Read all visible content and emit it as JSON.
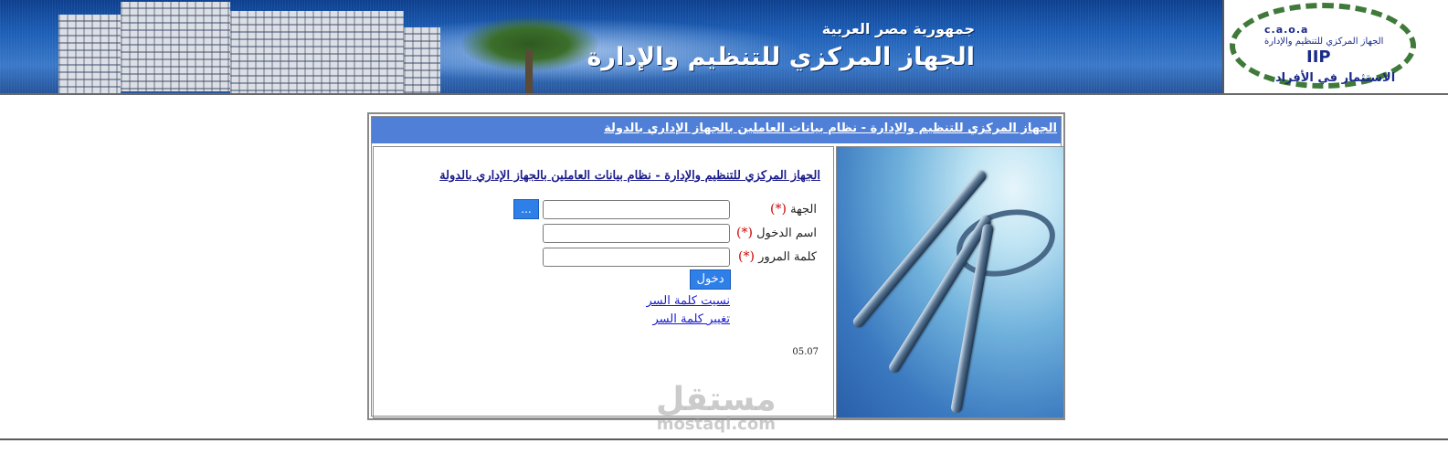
{
  "banner": {
    "subtitle": "جمهورية مصر العربية",
    "title": "الجهاز المركزي للتنظيم والإدارة",
    "logo_top": "c.a.o.a",
    "logo_sub": "الجهاز المركزي للتنظيم والإدارة",
    "logo_center": "IIP",
    "logo_bottom": "الاستثمار في الأفراد"
  },
  "frame": {
    "title": "الجهاز المركزي للتنظيم والإدارة - نظام بيانات العاملين بالجهاز الإداري بالدولة",
    "heading": "الجهاز المركزي للتنظيم والإدارة - نظام بيانات العاملين بالجهاز الإداري بالدولة"
  },
  "form": {
    "entity_label": "الجهة",
    "entity_value": "",
    "browse_label": "...",
    "username_label": "اسم الدخول",
    "username_value": "",
    "password_label": "كلمة المرور",
    "password_value": "",
    "required_marker": "(*)",
    "login_label": "دخول",
    "forgot_password": "نسيت كلمة السر",
    "change_password": "تغيير كلمة السر",
    "version": "05.07"
  },
  "watermark": {
    "arabic": "مستقل",
    "latin": "mostaql.com"
  }
}
